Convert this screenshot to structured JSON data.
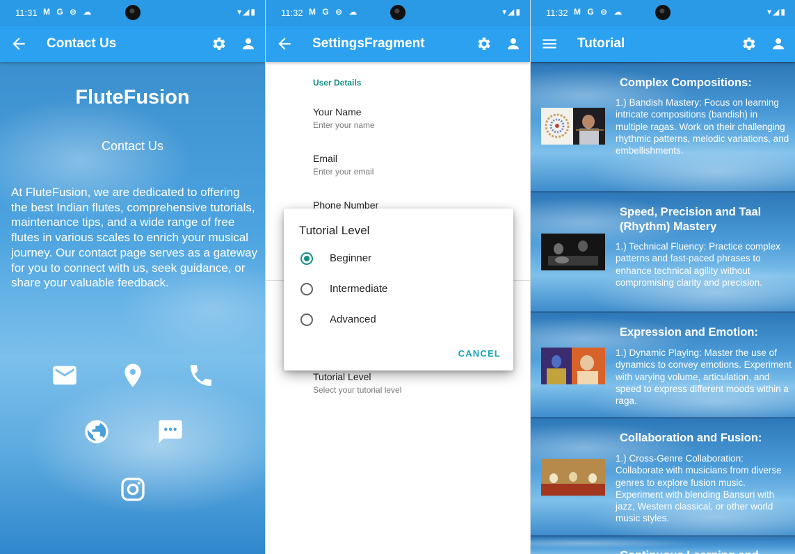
{
  "screens": [
    {
      "status_time": "11:31",
      "title": "Contact Us",
      "brand": "FluteFusion",
      "subheading": "Contact Us",
      "paragraph": "At FluteFusion, we are dedicated to offering the best Indian flutes, comprehensive tutorials, maintenance tips, and a wide range of free flutes in various scales to enrich your musical journey. Our contact page serves as a gateway for you to connect with us, seek guidance, or share your valuable feedback.",
      "contact_icons": [
        "email-icon",
        "location-icon",
        "phone-icon",
        "website-icon",
        "chat-icon",
        "instagram-icon"
      ]
    },
    {
      "status_time": "11:32",
      "title": "SettingsFragment",
      "category": "User Details",
      "prefs": [
        {
          "title": "Your Name",
          "summary": "Enter your name"
        },
        {
          "title": "Email",
          "summary": "Enter your email"
        },
        {
          "title": "Phone Number",
          "summary": ""
        },
        {
          "title": "Tutorial Level",
          "summary": "Select your tutorial level"
        }
      ],
      "dialog": {
        "title": "Tutorial Level",
        "options": [
          "Beginner",
          "Intermediate",
          "Advanced"
        ],
        "selected": "Beginner",
        "cancel": "CANCEL"
      }
    },
    {
      "status_time": "11:32",
      "title": "Tutorial",
      "cards": [
        {
          "heading": "Complex Compositions:",
          "text": "1.) Bandish Mastery: Focus on learning intricate compositions (bandish) in multiple ragas. Work on their challenging rhythmic patterns, melodic variations, and embellishments."
        },
        {
          "heading": "Speed, Precision and Taal (Rhythm) Mastery",
          "text": "1.) Technical Fluency: Practice complex patterns and fast-paced phrases to enhance technical agility without compromising clarity and precision."
        },
        {
          "heading": "Expression and Emotion:",
          "text": "1.) Dynamic Playing: Master the use of dynamics to convey emotions. Experiment with varying volume, articulation, and speed to express different moods within a raga."
        },
        {
          "heading": "Collaboration and Fusion:",
          "text": "1.) Cross-Genre Collaboration: Collaborate with musicians from diverse genres to explore fusion music. Experiment with blending Bansuri with jazz, Western classical, or other world music styles."
        },
        {
          "heading": "Continuous Learning and",
          "text": ""
        }
      ]
    }
  ],
  "colors": {
    "appbar": "#2ba1f0",
    "statusbar": "#2a9ae6",
    "accent": "#148f86",
    "cancel": "#17a3b8"
  },
  "status_icons": {
    "notifications": "M G ⊖ ☁",
    "system": "▾◢▮"
  }
}
